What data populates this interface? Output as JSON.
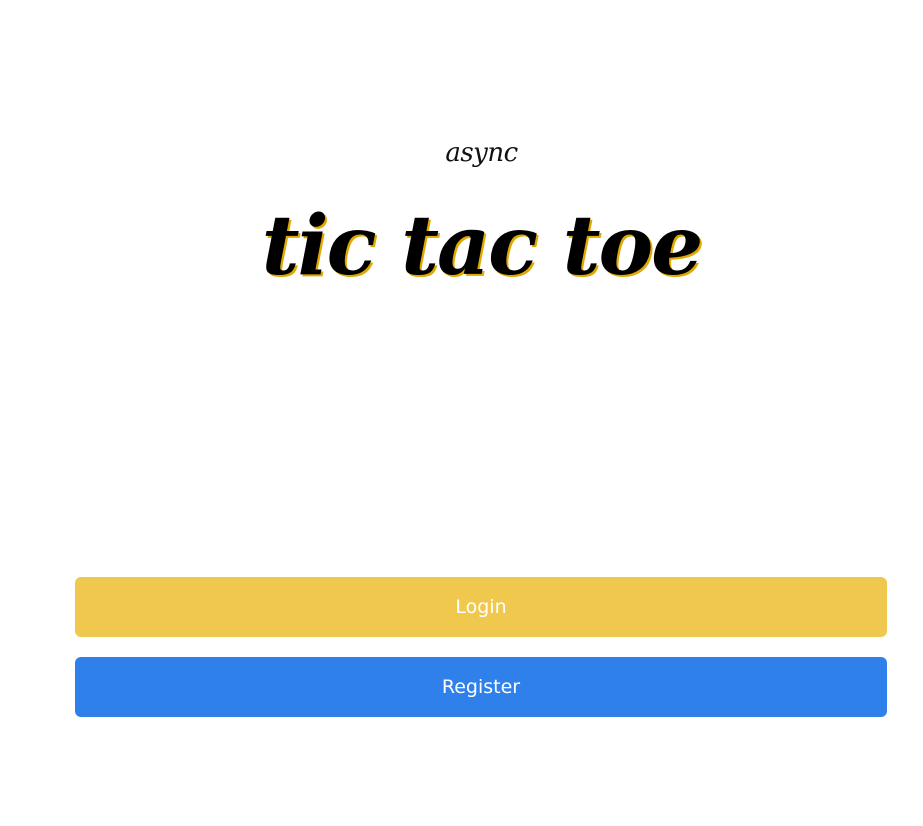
{
  "header": {
    "subtitle": "async",
    "title": "tic tac toe"
  },
  "actions": {
    "login_label": "Login",
    "register_label": "Register"
  },
  "colors": {
    "login_button": "#f1c84e",
    "register_button": "#2f80eb",
    "title_shadow": "#e0a800"
  }
}
